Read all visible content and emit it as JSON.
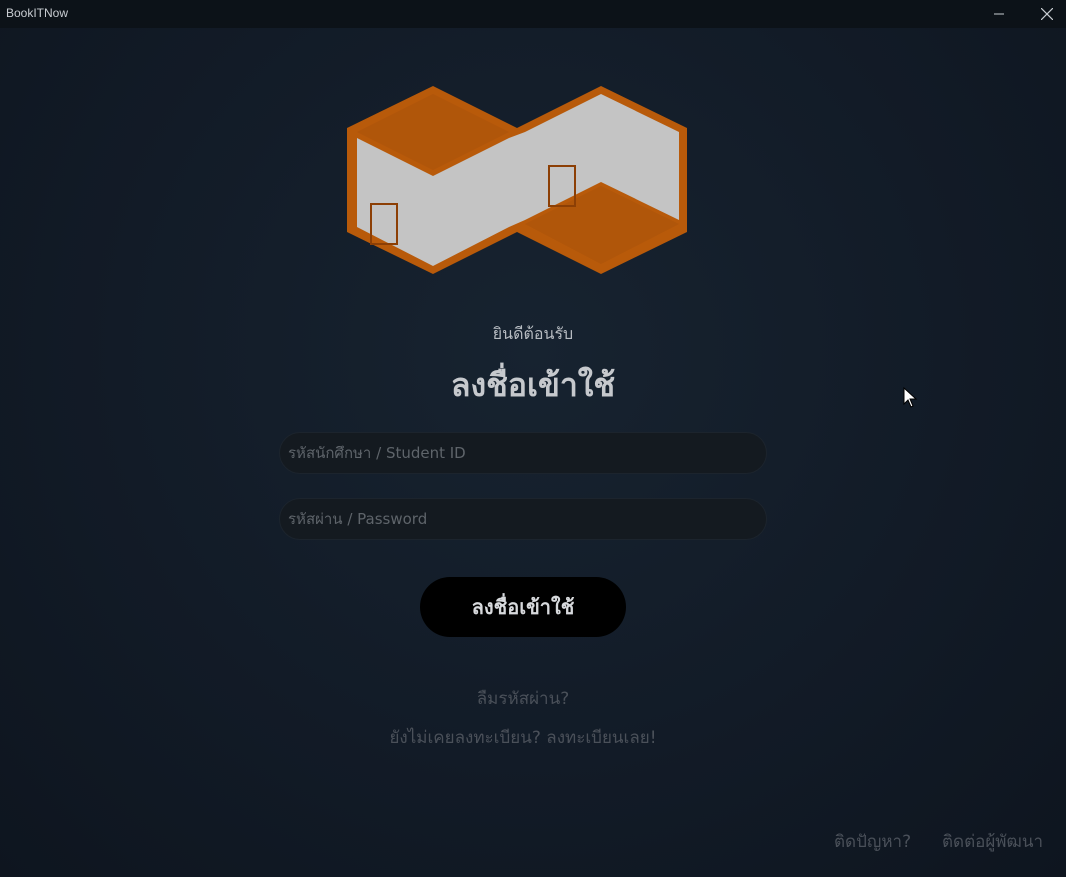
{
  "window": {
    "title": "BookITNow",
    "minimize_icon": "minimize-icon",
    "close_icon": "close-icon"
  },
  "logo": {
    "icon": "building-floorplan-logo",
    "colors": {
      "orange": "#b85a0a",
      "orange_dark": "#8c3f05",
      "wall": "#c4c4c4"
    }
  },
  "login": {
    "welcome": "ยินดีต้อนรับ",
    "heading": "ลงชื่อเข้าใช้",
    "student_id_placeholder": "รหัสนักศึกษา / Student ID",
    "password_placeholder": "รหัสผ่าน / Password",
    "submit_label": "ลงชื่อเข้าใช้",
    "forgot_password": "ลืมรหัสผ่าน?",
    "no_account": "ยังไม่เคยลงทะเบียน?",
    "register_now": "ลงทะเบียนเลย!"
  },
  "footer": {
    "help": "ติดปัญหา?",
    "contact_dev": "ติดต่อผู้พัฒนา"
  }
}
